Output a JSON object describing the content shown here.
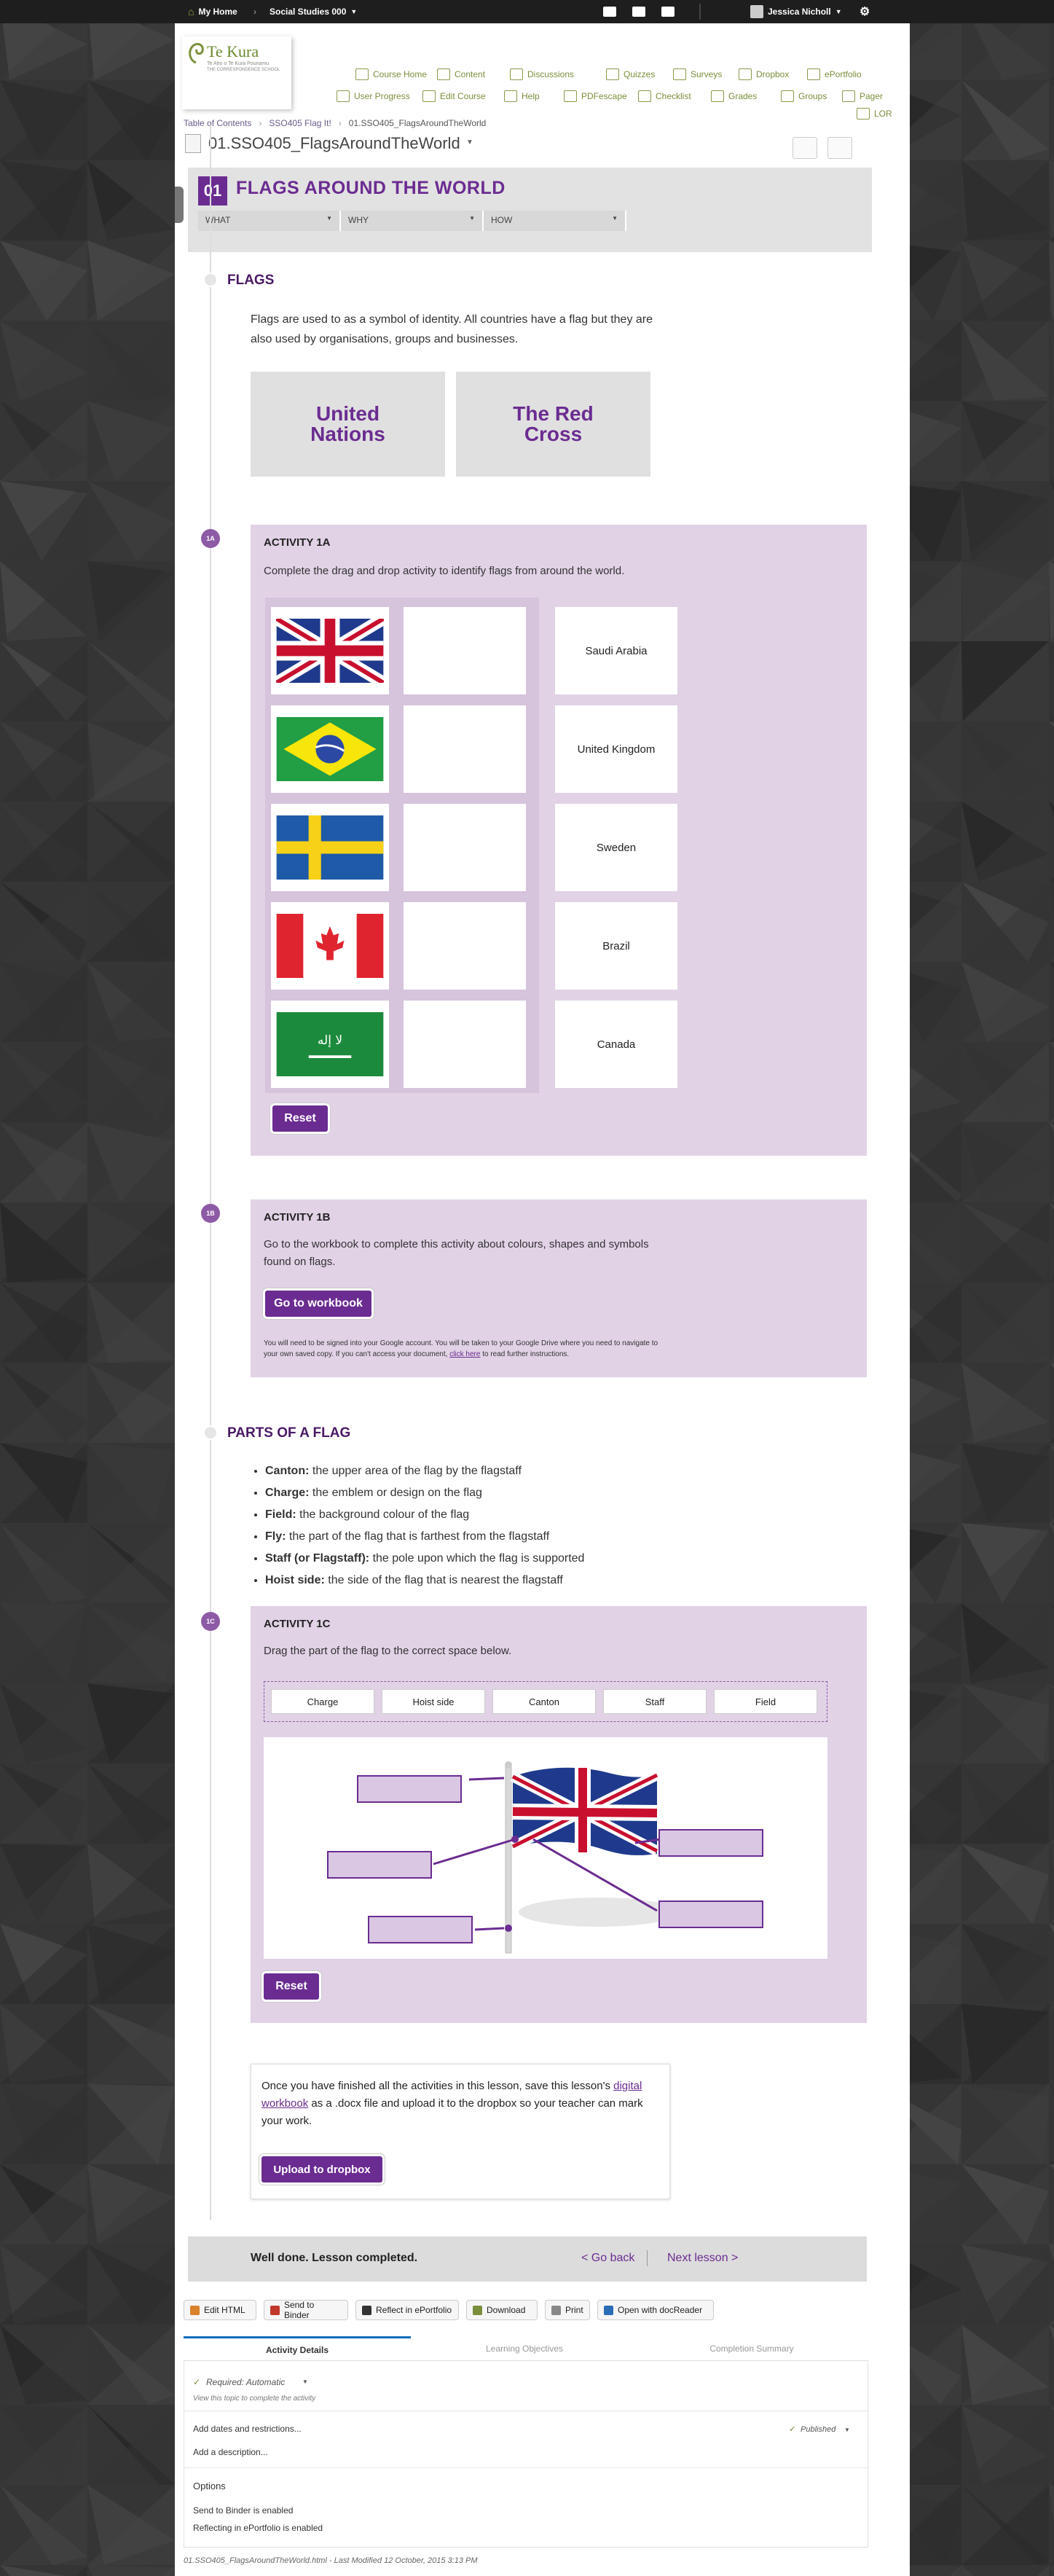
{
  "topbar": {
    "home": "My Home",
    "course": "Social Studies 000",
    "user": "Jessica Nicholl"
  },
  "logo": {
    "name": "Te Kura",
    "tagline": "Te Aho o Te Kura Pounamu",
    "subtitle": "THE CORRESPONDENCE SCHOOL"
  },
  "nav": {
    "row1": [
      "Course Home",
      "Content",
      "Discussions",
      "Quizzes",
      "Surveys",
      "Dropbox",
      "ePortfolio"
    ],
    "row2": [
      "User Progress",
      "Edit Course",
      "Help",
      "PDFescape",
      "Checklist",
      "Grades",
      "Groups",
      "Pager"
    ],
    "row3": [
      "LOR"
    ]
  },
  "breadcrumb": [
    "Table of Contents",
    "SSO405 Flag It!",
    "01.SSO405_FlagsAroundTheWorld"
  ],
  "topic_title": "01.SSO405_FlagsAroundTheWorld",
  "lesson": {
    "number": "01",
    "title": "FLAGS AROUND THE WORLD",
    "tabs": [
      "WHAT",
      "WHY",
      "HOW"
    ]
  },
  "flags_section": {
    "title": "FLAGS",
    "text": "Flags are used to as a symbol of identity. All countries have a flag but they are also used by organisations, groups and businesses.",
    "cards": [
      "United Nations",
      "The Red Cross"
    ]
  },
  "activity_1a": {
    "badge": "1A",
    "title": "ACTIVITY 1A",
    "text": "Complete the drag and drop activity to identify flags from around the world.",
    "flags": [
      "uk-flag",
      "brazil-flag",
      "sweden-flag",
      "canada-flag",
      "saudi-arabia-flag"
    ],
    "names": [
      "Saudi Arabia",
      "United Kingdom",
      "Sweden",
      "Brazil",
      "Canada"
    ],
    "reset": "Reset"
  },
  "activity_1b": {
    "badge": "1B",
    "title": "ACTIVITY 1B",
    "text": "Go to the workbook to complete this activity about colours, shapes and symbols found on flags.",
    "button": "Go to workbook",
    "note_before": "You will need to be signed into your Google account. You will be taken to your Google Drive where you need to navigate to your own saved copy. If you can't access your document,",
    "note_link": "click here",
    "note_after": "to read further instructions."
  },
  "parts_section": {
    "title": "PARTS OF A FLAG",
    "items": [
      {
        "term": "Canton:",
        "def": "the upper area of the flag by the flagstaff"
      },
      {
        "term": "Charge:",
        "def": "the emblem or design on the flag"
      },
      {
        "term": "Field:",
        "def": "the background colour of the flag"
      },
      {
        "term": "Fly:",
        "def": "the part of the flag that is farthest from the flagstaff"
      },
      {
        "term": "Staff (or Flagstaff):",
        "def": "the pole upon which the flag is supported"
      },
      {
        "term": "Hoist side:",
        "def": "the side of the flag that is nearest the flagstaff"
      }
    ]
  },
  "activity_1c": {
    "badge": "1C",
    "title": "ACTIVITY 1C",
    "text": "Drag the part of the flag to the correct space below.",
    "chips": [
      "Charge",
      "Hoist side",
      "Canton",
      "Staff",
      "Field"
    ],
    "reset": "Reset"
  },
  "completion": {
    "text_before": "Once you have finished all the activities in this lesson, save this lesson's",
    "link": "digital workbook",
    "text_after": "as a .docx file and upload it to the dropbox so your teacher can mark your work.",
    "button": "Upload to dropbox"
  },
  "footer_bar": {
    "done": "Well done. Lesson completed.",
    "back": "< Go back",
    "next": "Next lesson >"
  },
  "toolbar": [
    "Edit HTML",
    "Send to Binder",
    "Reflect in ePortfolio",
    "Download",
    "Print",
    "Open with docReader"
  ],
  "detail_tabs": [
    "Activity Details",
    "Learning Objectives",
    "Completion Summary"
  ],
  "details": {
    "required": "Required: Automatic",
    "view_note": "View this topic to complete the activity",
    "add_dates": "Add dates and restrictions...",
    "published": "Published",
    "add_desc": "Add a description...",
    "options": "Options",
    "binder": "Send to Binder is enabled",
    "reflect": "Reflecting in ePortfolio is enabled"
  },
  "modified": "01.SSO405_FlagsAroundTheWorld.html - Last Modified 12 October, 2015 3:13 PM"
}
